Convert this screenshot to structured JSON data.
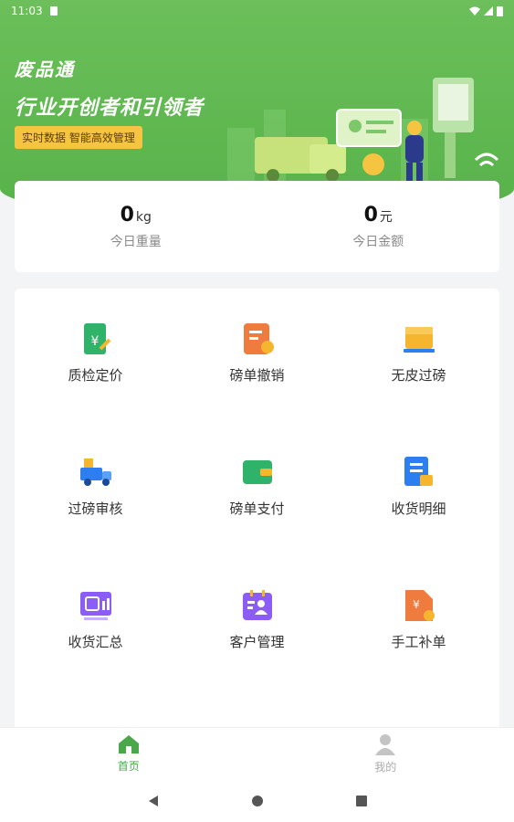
{
  "status_bar": {
    "time": "11:03"
  },
  "hero": {
    "brand": "废品通",
    "slogan": "行业开创者和引领者",
    "tag": "实时数据 智能高效管理"
  },
  "stats": [
    {
      "value": "0",
      "unit": "kg",
      "label": "今日重量"
    },
    {
      "value": "0",
      "unit": "元",
      "label": "今日金额"
    }
  ],
  "menu": [
    {
      "label": "质检定价",
      "icon": "quality-pricing-icon",
      "color": "#2fb36a"
    },
    {
      "label": "磅单撤销",
      "icon": "weighbill-cancel-icon",
      "color": "#f07b3f"
    },
    {
      "label": "无皮过磅",
      "icon": "box-weigh-icon",
      "color": "#f6b52e"
    },
    {
      "label": "过磅审核",
      "icon": "truck-audit-icon",
      "color": "#2d7ef0"
    },
    {
      "label": "磅单支付",
      "icon": "wallet-pay-icon",
      "color": "#2fb36a"
    },
    {
      "label": "收货明细",
      "icon": "receipt-detail-icon",
      "color": "#2d7ef0"
    },
    {
      "label": "收货汇总",
      "icon": "receipt-summary-icon",
      "color": "#8b5cf6"
    },
    {
      "label": "客户管理",
      "icon": "customer-manage-icon",
      "color": "#8b5cf6"
    },
    {
      "label": "手工补单",
      "icon": "manual-order-icon",
      "color": "#f07b3f"
    }
  ],
  "bottom_nav": [
    {
      "label": "首页",
      "icon": "home-icon",
      "active": true
    },
    {
      "label": "我的",
      "icon": "user-icon",
      "active": false
    }
  ],
  "colors": {
    "primary": "#57b24a",
    "accent": "#f5c542"
  }
}
